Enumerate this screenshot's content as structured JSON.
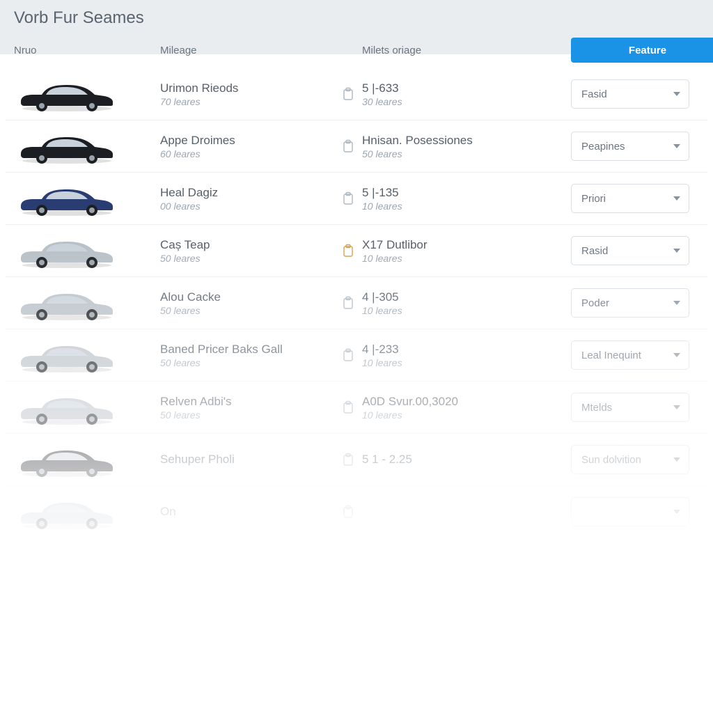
{
  "title": "Vorb Fur Seames",
  "columns": {
    "c1": "Nruo",
    "c2": "Mileage",
    "c3": "Milets oriage"
  },
  "feature_button": "Feature",
  "rows": [
    {
      "color": "dark",
      "mile": "Urimon Rieods",
      "mile_sub": "70 leares",
      "icon": "clip",
      "origin": "5 |-633",
      "origin_sub": "30 leares",
      "select": "Fasid"
    },
    {
      "color": "dark",
      "mile": "Appe Droimes",
      "mile_sub": "60 leares",
      "icon": "clip",
      "origin": "Hnisan. Posessiones",
      "origin_sub": "50 leares",
      "select": "Peapines"
    },
    {
      "color": "blue",
      "mile": "Heal Dagiz",
      "mile_sub": "00 leares",
      "icon": "clip",
      "origin": "5 |-135",
      "origin_sub": "10 leares",
      "select": "Priori"
    },
    {
      "color": "silver",
      "mile": "Caș Teap",
      "mile_sub": "50 leares",
      "icon": "special",
      "origin": "X17 Dutlibor",
      "origin_sub": "10 leares",
      "select": "Rasid"
    },
    {
      "color": "silver",
      "mile": "Alou Cacke",
      "mile_sub": "50 leares",
      "icon": "clip",
      "origin": "4 |-305",
      "origin_sub": "10 leares",
      "select": "Poder"
    },
    {
      "color": "silver",
      "mile": "Baned Pricer Baks Gall",
      "mile_sub": "50 leares",
      "icon": "clip",
      "origin": "4 |-233",
      "origin_sub": "10 leares",
      "select": "Leal Inequint"
    },
    {
      "color": "silver",
      "mile": "Relven Adbi's",
      "mile_sub": "50 leares",
      "icon": "clip",
      "origin": "A0D Svur.00,3020",
      "origin_sub": "10 leares",
      "select": "Mtelds"
    },
    {
      "color": "dark",
      "mile": "Sehuper Pholi",
      "mile_sub": "",
      "icon": "clip",
      "origin": "5 1 - 2.25",
      "origin_sub": "",
      "select": "Sun dolvition"
    },
    {
      "color": "silver",
      "mile": "On",
      "mile_sub": "",
      "icon": "clip",
      "origin": "",
      "origin_sub": "",
      "select": ""
    }
  ]
}
